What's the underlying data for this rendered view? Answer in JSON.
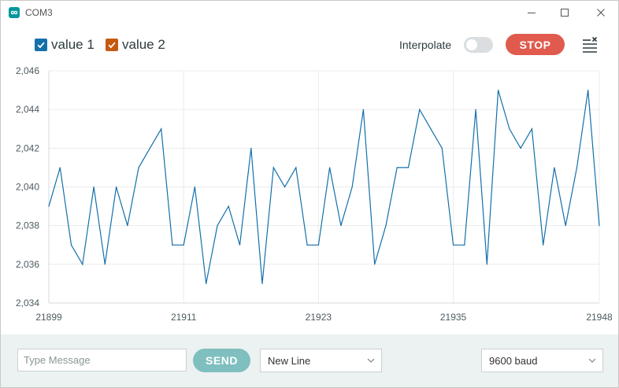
{
  "window": {
    "title": "COM3",
    "app_icon": "infinity-logo-icon",
    "controls": [
      "minimize-icon",
      "maximize-icon",
      "close-icon"
    ]
  },
  "toolbar": {
    "interpolate_label": "Interpolate",
    "interpolate_on": false,
    "stop_label": "STOP",
    "clear_icon": "clear-list-icon"
  },
  "colors": {
    "value1": "#1370ab",
    "value2": "#c55a11",
    "stop": "#e05b4d",
    "send": "#7fbfbf",
    "line": "#1370ab",
    "grid": "#ebebeb"
  },
  "bottom": {
    "message_placeholder": "Type Message",
    "message_value": "",
    "send_label": "SEND",
    "line_ending": "New Line",
    "baud": "9600 baud"
  },
  "chart_data": {
    "type": "line",
    "title": "",
    "xlabel": "",
    "ylabel": "",
    "legend": [
      {
        "name": "value 1",
        "checked": true,
        "color": "#1370ab"
      },
      {
        "name": "value 2",
        "checked": true,
        "color": "#c55a11"
      }
    ],
    "xlim": [
      21899,
      21948
    ],
    "ylim": [
      2034,
      2046
    ],
    "xticks": [
      21899,
      21911,
      21923,
      21935,
      21948
    ],
    "xtick_labels": [
      "21899",
      "21911",
      "21923",
      "21935",
      "21948"
    ],
    "yticks": [
      2034,
      2036,
      2038,
      2040,
      2042,
      2044,
      2046
    ],
    "ytick_labels": [
      "2,034",
      "2,036",
      "2,038",
      "2,040",
      "2,042",
      "2,044",
      "2,046"
    ],
    "grid": true,
    "series": [
      {
        "name": "value 1",
        "x": [
          21899,
          21900,
          21901,
          21902,
          21903,
          21904,
          21905,
          21906,
          21907,
          21908,
          21909,
          21910,
          21911,
          21912,
          21913,
          21914,
          21915,
          21916,
          21917,
          21918,
          21919,
          21920,
          21921,
          21922,
          21923,
          21924,
          21925,
          21926,
          21927,
          21928,
          21929,
          21930,
          21931,
          21932,
          21933,
          21934,
          21935,
          21936,
          21937,
          21938,
          21939,
          21940,
          21941,
          21942,
          21943,
          21944,
          21945,
          21946,
          21947,
          21948
        ],
        "y": [
          2039,
          2041,
          2037,
          2036,
          2040,
          2036,
          2040,
          2038,
          2041,
          2042,
          2043,
          2037,
          2037,
          2040,
          2035,
          2038,
          2039,
          2037,
          2042,
          2035,
          2041,
          2040,
          2041,
          2037,
          2037,
          2041,
          2038,
          2040,
          2044,
          2036,
          2038,
          2041,
          2041,
          2044,
          2043,
          2042,
          2037,
          2037,
          2044,
          2036,
          2045,
          2043,
          2042,
          2043,
          2037,
          2041,
          2038,
          2041,
          2045,
          2038
        ]
      },
      {
        "name": "value 2",
        "x": [],
        "y": []
      }
    ]
  }
}
